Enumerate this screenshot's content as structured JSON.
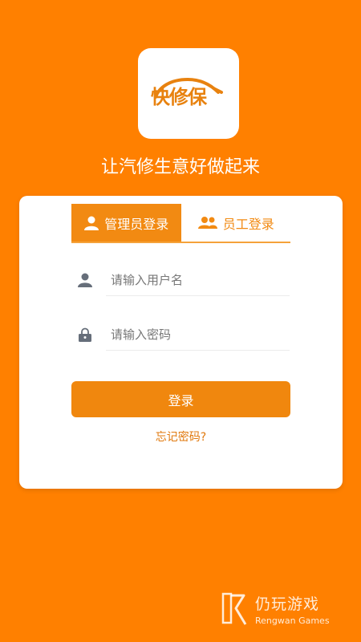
{
  "app": {
    "logo_text": "快修保",
    "slogan": "让汽修生意好做起来"
  },
  "tabs": [
    {
      "label": "管理员登录",
      "icon": "person-icon",
      "active": true
    },
    {
      "label": "员工登录",
      "icon": "people-icon",
      "active": false
    }
  ],
  "form": {
    "username": {
      "placeholder": "请输入用户名",
      "value": "",
      "icon": "user-icon"
    },
    "password": {
      "placeholder": "请输入密码",
      "value": "",
      "icon": "lock-icon"
    },
    "login_label": "登录",
    "forgot_label": "忘记密码?"
  },
  "watermark": {
    "title": "仍玩游戏",
    "subtitle": "Rengwan Games"
  },
  "colors": {
    "background": "#FF8000",
    "accent": "#F28A12",
    "card": "#FFFFFF"
  }
}
